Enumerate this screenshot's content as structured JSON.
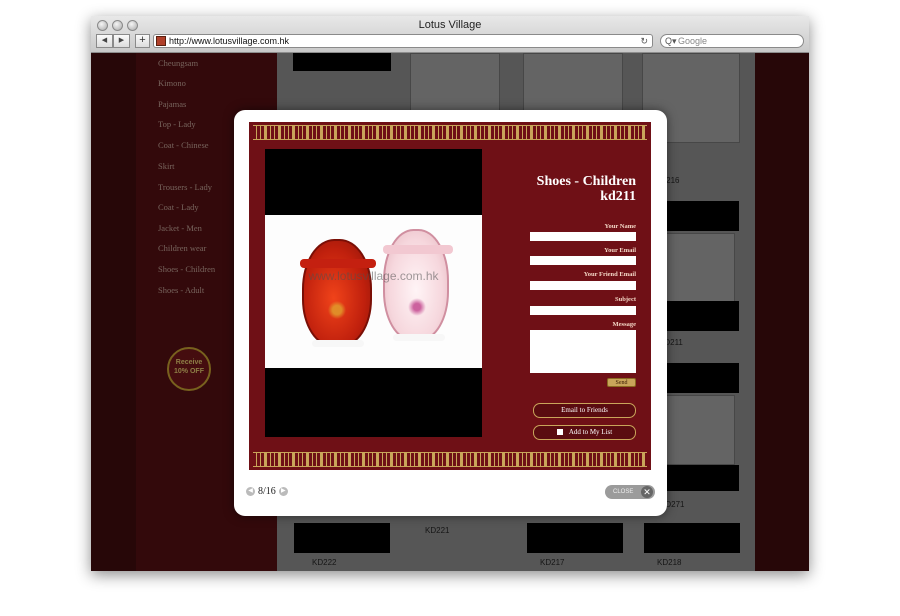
{
  "browser": {
    "window_title": "Lotus Village",
    "back_glyph": "◀",
    "forward_glyph": "▶",
    "new_tab_glyph": "+",
    "url": "http://www.lotusvillage.com.hk",
    "reload_glyph": "↻",
    "search_placeholder": "Google",
    "search_glyph": "Q▾"
  },
  "background_page": {
    "nav_items": [
      "Cheungsam",
      "Kimono",
      "Pajamas",
      "Top - Lady",
      "Coat - Chinese",
      "Skirt",
      "Trousers - Lady",
      "Coat - Lady",
      "Jacket - Men",
      "Children wear",
      "Shoes - Children",
      "Shoes - Adult"
    ],
    "promo_badge": "Receive 10% OFF",
    "codes": [
      "KD216",
      "KD211",
      "KD271",
      "KD221",
      "KD222",
      "KD217",
      "KD218"
    ]
  },
  "lightbox": {
    "product_category": "Shoes - Children",
    "product_code": "kd211",
    "watermark": "www.lotusvillage.com.hk",
    "form": {
      "your_name_label": "Your Name",
      "your_email_label": "Your Email",
      "friend_email_label": "Your Friend Email",
      "subject_label": "Subject",
      "message_label": "Message",
      "send_label": "Send"
    },
    "email_friends_label": "Email to Friends",
    "add_list_label": "Add to My List",
    "pager": {
      "text": "8/16",
      "prev_glyph": "◀",
      "next_glyph": "▶"
    },
    "close_label": "CLOSE",
    "close_glyph": "✕"
  },
  "colors": {
    "frame_red": "#6f1016",
    "gold": "#c9a55a"
  }
}
